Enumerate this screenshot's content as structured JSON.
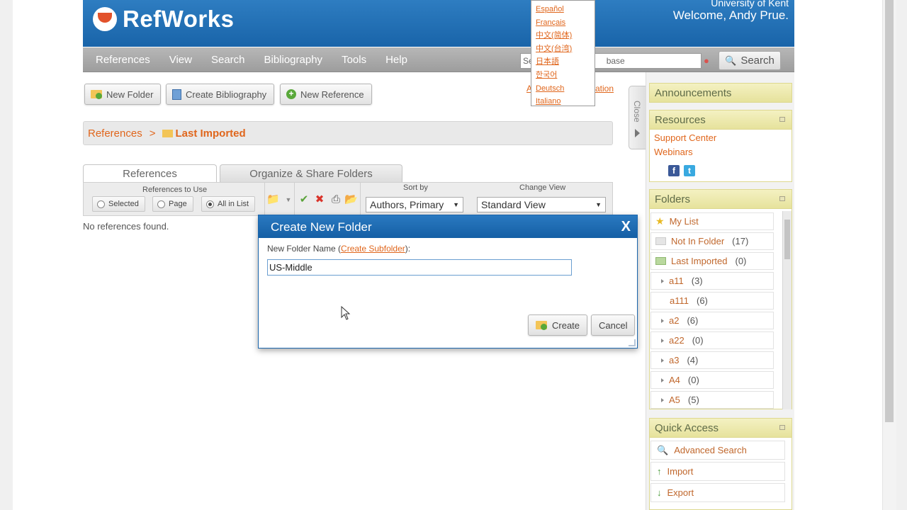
{
  "header": {
    "logo_text": "RefWorks",
    "university": "University of Kent",
    "welcome": "Welcome, Andy Prue."
  },
  "nav": {
    "items": [
      "References",
      "View",
      "Search",
      "Bibliography",
      "Tools",
      "Help"
    ],
    "search_left": "Se",
    "search_right": "base",
    "search_button": "Search"
  },
  "languages": [
    "Español",
    "Français",
    "中文(简体)",
    "中文(台湾)",
    "日本語",
    "한국어",
    "Deutsch",
    "Italiano"
  ],
  "advanced_links": {
    "left": "A",
    "right": "ation"
  },
  "toolbar": {
    "new_folder": "New Folder",
    "create_bibliography": "Create Bibliography",
    "new_reference": "New Reference"
  },
  "breadcrumb": {
    "root": "References",
    "separator": ">",
    "current": "Last Imported"
  },
  "tabs": {
    "references": "References",
    "organize": "Organize & Share Folders"
  },
  "refbar": {
    "references_to_use": "References to Use",
    "options": [
      "Selected",
      "Page",
      "All in List"
    ],
    "selected_option": "All in List",
    "sort_by_label": "Sort by",
    "sort_by_value": "Authors, Primary",
    "change_view_label": "Change View",
    "change_view_value": "Standard View"
  },
  "main": {
    "no_refs": "No references found."
  },
  "close_tab": "Close",
  "announcements": {
    "title": "Announcements"
  },
  "resources": {
    "title": "Resources",
    "links": [
      "Support Center",
      "Webinars"
    ]
  },
  "folders": {
    "title": "Folders",
    "items": [
      {
        "name": "My List",
        "count": ""
      },
      {
        "name": "Not In Folder",
        "count": "(17)"
      },
      {
        "name": "Last Imported",
        "count": "(0)"
      },
      {
        "name": "a11",
        "count": "(3)"
      },
      {
        "name": "a111",
        "count": "(6)"
      },
      {
        "name": "a2",
        "count": "(6)"
      },
      {
        "name": "a22",
        "count": "(0)"
      },
      {
        "name": "a3",
        "count": "(4)"
      },
      {
        "name": "A4",
        "count": "(0)"
      },
      {
        "name": "A5",
        "count": "(5)"
      }
    ]
  },
  "quick_access": {
    "title": "Quick Access",
    "items": [
      "Advanced Search",
      "Import",
      "Export"
    ]
  },
  "modal": {
    "title": "Create New Folder",
    "close": "X",
    "label_prefix": "New Folder Name (",
    "label_link": "Create Subfolder",
    "label_suffix": "):",
    "input_value": "US-Middle",
    "create_button": "Create",
    "cancel_button": "Cancel"
  },
  "colors": {
    "header_blue": "#1964a9",
    "link_orange": "#e0661c",
    "panel_yellow": "#e6e29c"
  }
}
